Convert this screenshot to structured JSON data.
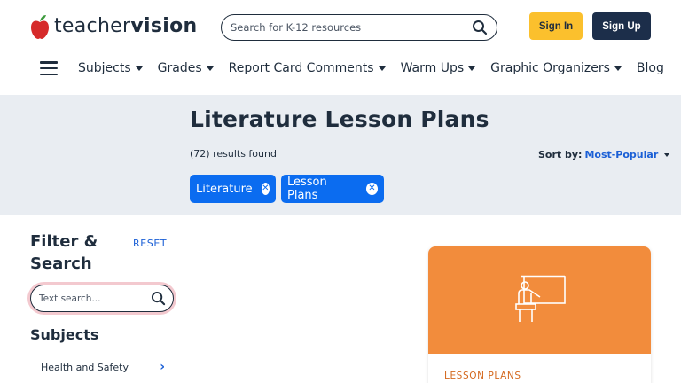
{
  "brand": {
    "name_light": "teacher",
    "name_bold": "vision",
    "apple_color": "#d62a2a",
    "leaf_color": "#3c9a3c"
  },
  "header": {
    "search_placeholder": "Search for K-12 resources",
    "search_icon": "search-icon",
    "signin_label": "Sign In",
    "signup_label": "Sign Up",
    "signin_color": "#fbc02d",
    "signup_color": "#1c2e4a"
  },
  "nav": {
    "menu_icon": "hamburger-menu-icon",
    "items": [
      {
        "label": "Subjects",
        "dropdown": true
      },
      {
        "label": "Grades",
        "dropdown": true
      },
      {
        "label": "Report Card Comments",
        "dropdown": true
      },
      {
        "label": "Warm Ups",
        "dropdown": true
      },
      {
        "label": "Graphic Organizers",
        "dropdown": true
      },
      {
        "label": "Blog",
        "dropdown": false
      }
    ]
  },
  "hero": {
    "title": "Literature Lesson Plans",
    "results": "(72) results found",
    "sort_label": "Sort by:",
    "sort_value": "Most-Popular",
    "chips": [
      {
        "label": "Literature"
      },
      {
        "label": "Lesson Plans"
      }
    ],
    "chip_color": "#0b6cf0"
  },
  "sidebar": {
    "title": "Filter & Search",
    "reset": "RESET",
    "search_placeholder": "Text search...",
    "section": "Subjects",
    "items": [
      {
        "label": "Health and Safety"
      }
    ]
  },
  "card": {
    "category": "LESSON PLANS",
    "image_icon": "teacher-at-whiteboard-icon",
    "image_color": "#f28c3c"
  }
}
